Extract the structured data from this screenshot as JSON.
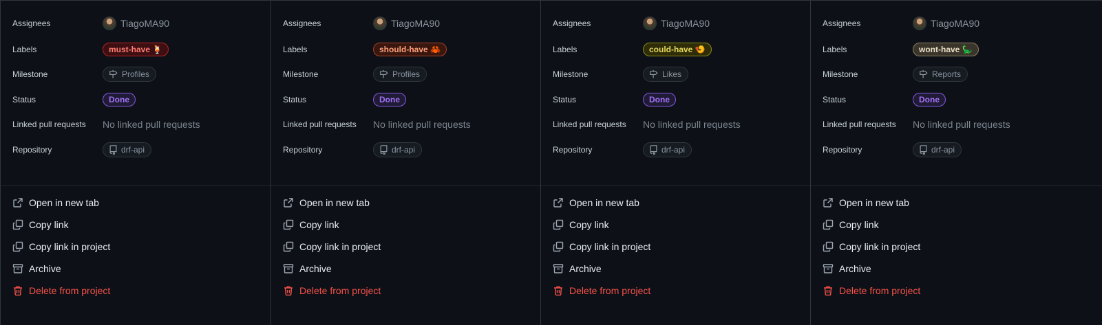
{
  "field_labels": {
    "assignees": "Assignees",
    "labels": "Labels",
    "milestone": "Milestone",
    "status": "Status",
    "linked_prs": "Linked pull requests",
    "repository": "Repository"
  },
  "actions": {
    "open_new_tab": "Open in new tab",
    "copy_link": "Copy link",
    "copy_link_project": "Copy link in project",
    "archive": "Archive",
    "delete": "Delete from project"
  },
  "icons": {
    "milestone": "milestone-icon",
    "repository": "repo-icon",
    "open": "link-external-icon",
    "copy": "copy-icon",
    "archive": "archive-icon",
    "delete": "trash-icon"
  },
  "panels": [
    {
      "assignee": "TiagoMA90",
      "label": "must-have 🍹",
      "label_colors": {
        "text": "#ff7b72",
        "border": "#b62324",
        "bg": "#3d0f12"
      },
      "milestone": "Profiles",
      "status": "Done",
      "linked_prs": "No linked pull requests",
      "repository": "drf-api"
    },
    {
      "assignee": "TiagoMA90",
      "label": "should-have 🦀",
      "label_colors": {
        "text": "#ff9f7a",
        "border": "#a4412a",
        "bg": "#3a170e"
      },
      "milestone": "Profiles",
      "status": "Done",
      "linked_prs": "No linked pull requests",
      "repository": "drf-api"
    },
    {
      "assignee": "TiagoMA90",
      "label": "could-have 🍤",
      "label_colors": {
        "text": "#e3d85a",
        "border": "#8a8a1c",
        "bg": "#2f2d08"
      },
      "milestone": "Likes",
      "status": "Done",
      "linked_prs": "No linked pull requests",
      "repository": "drf-api"
    },
    {
      "assignee": "TiagoMA90",
      "label": "wont-have 🦕",
      "label_colors": {
        "text": "#e8dcc4",
        "border": "#8b7e63",
        "bg": "#3a352a"
      },
      "milestone": "Reports",
      "status": "Done",
      "linked_prs": "No linked pull requests",
      "repository": "drf-api"
    }
  ]
}
